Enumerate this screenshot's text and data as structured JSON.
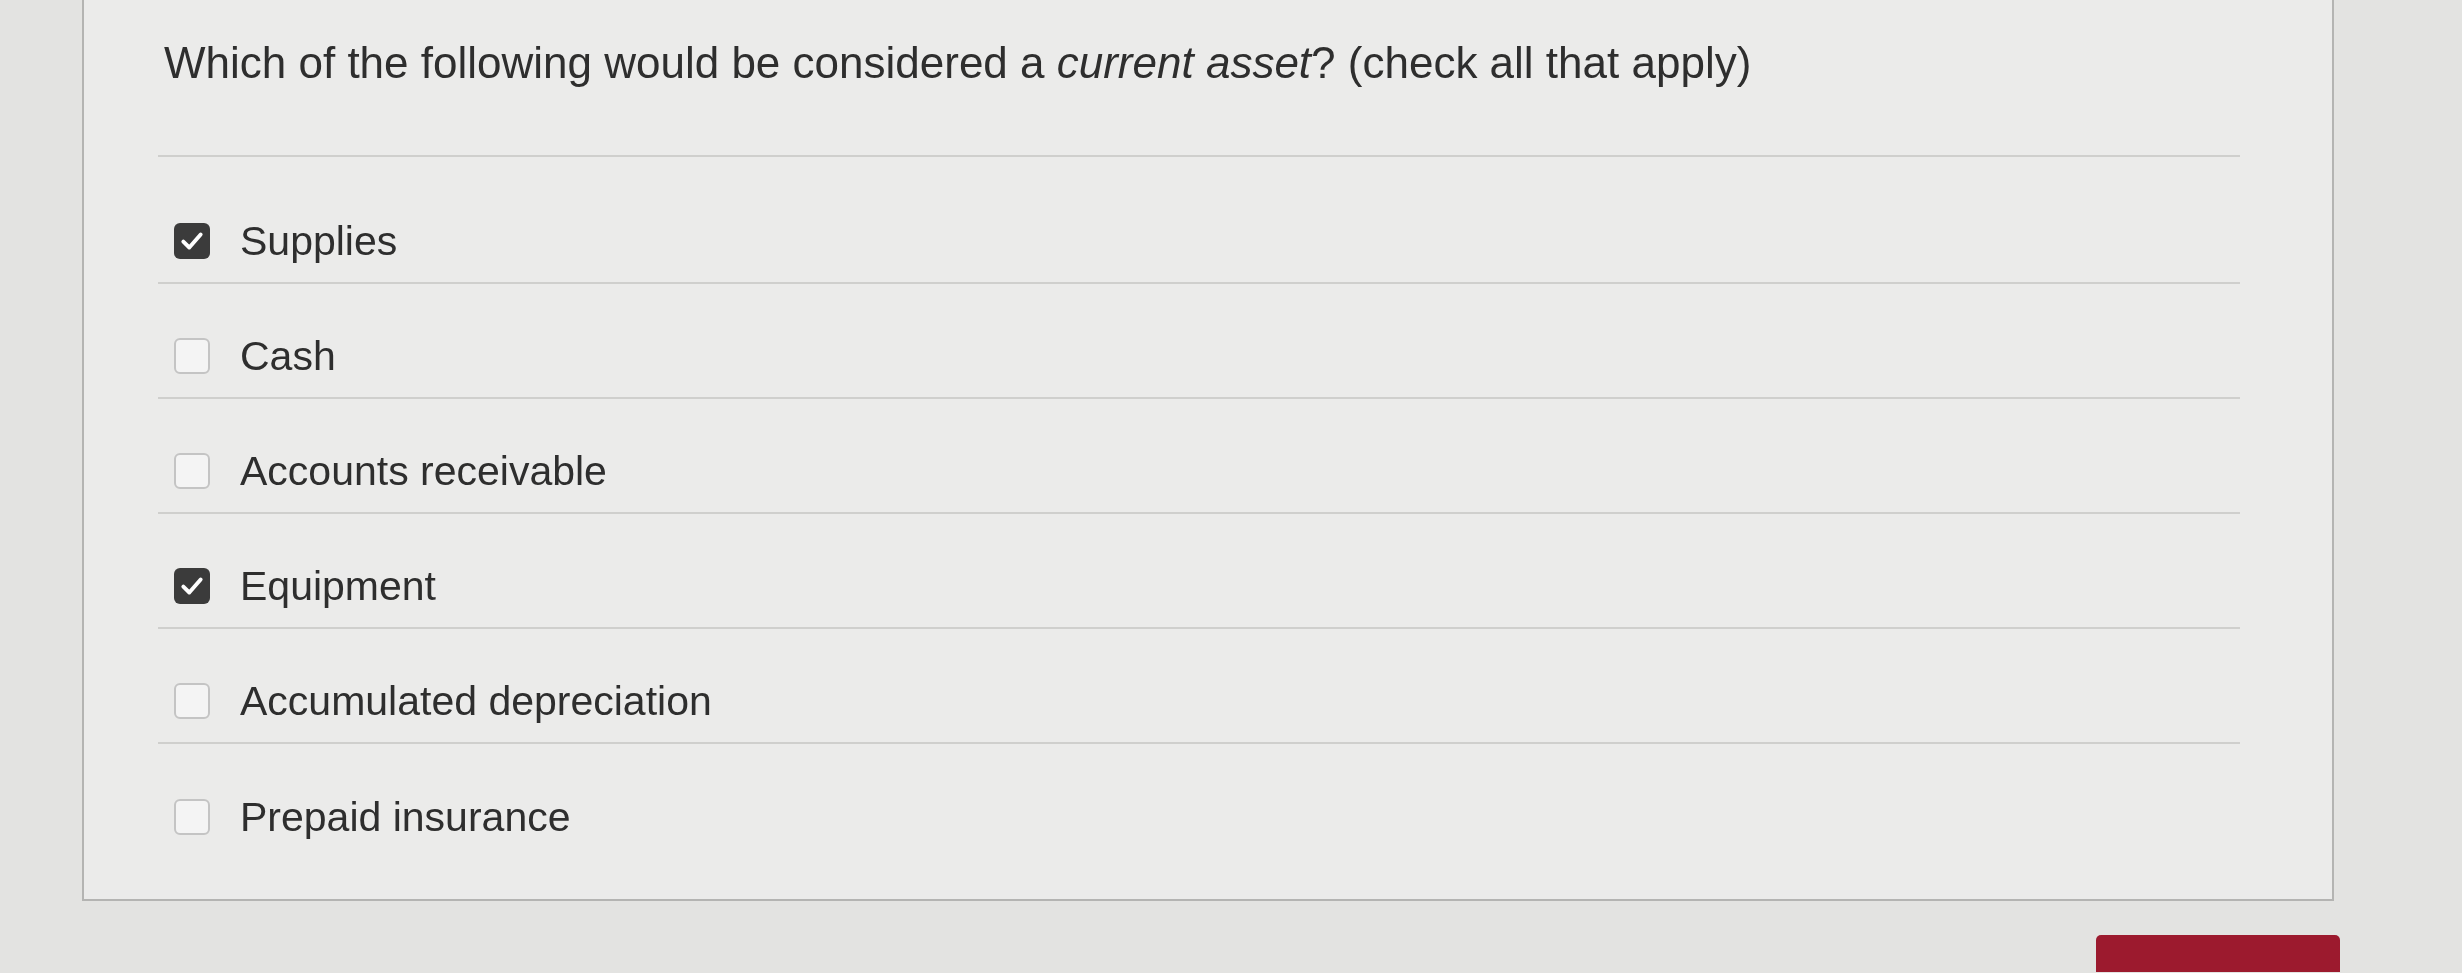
{
  "question": "Which of the following would be considered a *current asset*? (check all that apply)",
  "options": [
    {
      "label": "Supplies",
      "checked": true
    },
    {
      "label": "Cash",
      "checked": false
    },
    {
      "label": "Accounts receivable",
      "checked": false
    },
    {
      "label": "Equipment",
      "checked": true
    },
    {
      "label": "Accumulated depreciation",
      "checked": false
    },
    {
      "label": "Prepaid insurance",
      "checked": false
    }
  ]
}
